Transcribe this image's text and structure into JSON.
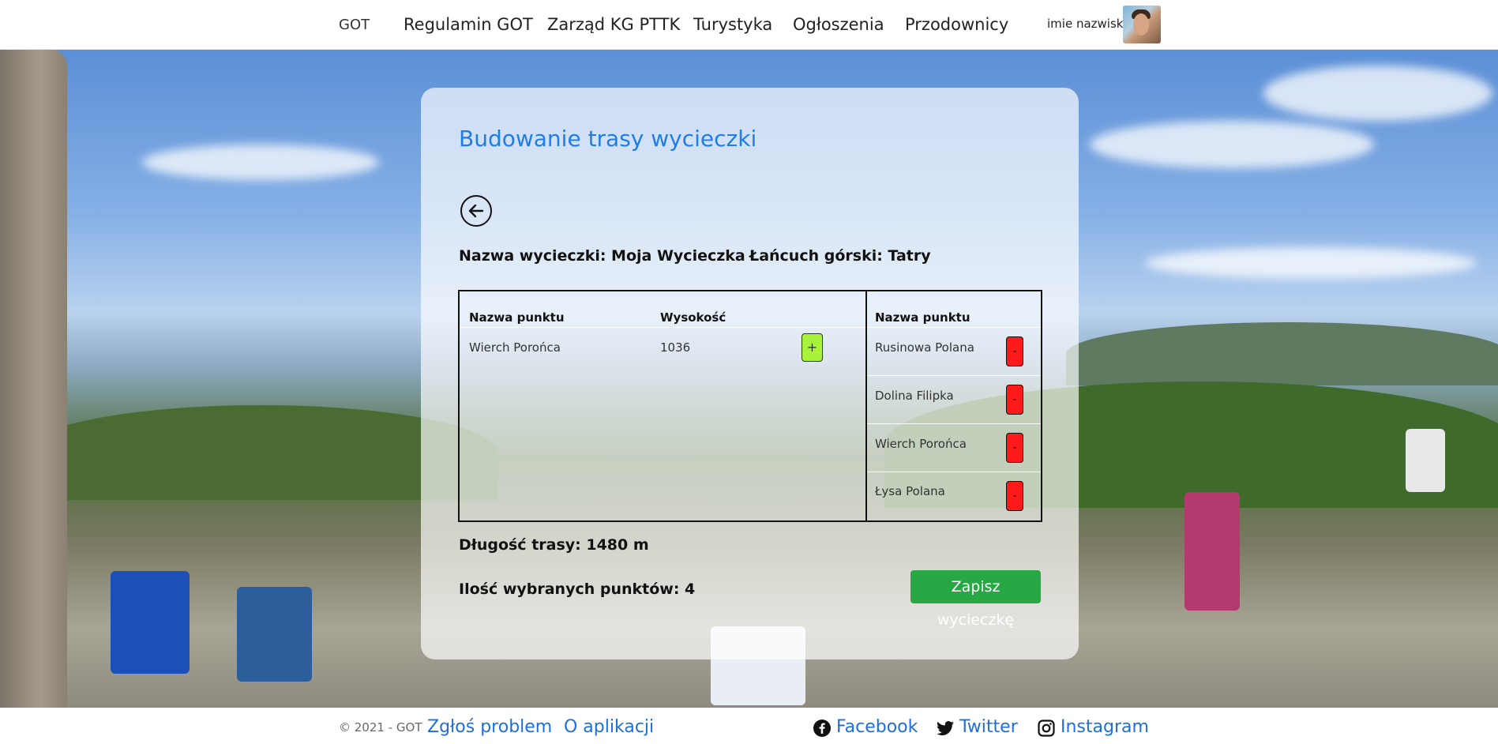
{
  "navbar": {
    "brand": "GOT",
    "links": [
      "Regulamin GOT",
      "Zarząd KG PTTK",
      "Turystyka",
      "Ogłoszenia",
      "Przodownicy"
    ],
    "user_name": "imie nazwisko"
  },
  "card": {
    "title": "Budowanie trasy wycieczki",
    "trip_name": "Nazwa wycieczki: Moja Wycieczka",
    "mountain_chain": "Łańcuch górski: Tatry",
    "available": {
      "headers": [
        "Nazwa punktu",
        "Wysokość"
      ],
      "rows": [
        {
          "name": "Wierch Porońca",
          "height": "1036",
          "action": "+"
        }
      ]
    },
    "selected": {
      "header": "Nazwa punktu",
      "rows": [
        {
          "name": "Rusinowa Polana",
          "action": "-"
        },
        {
          "name": "Dolina Filipka",
          "action": "-"
        },
        {
          "name": "Wierch Porońca",
          "action": "-"
        },
        {
          "name": "Łysa Polana",
          "action": "-"
        }
      ]
    },
    "route_length": "Długość trasy: 1480 m",
    "points_count": "Ilość wybranych punktów: 4",
    "save_label": "Zapisz wycieczkę"
  },
  "footer": {
    "copyright": "© 2021 - GOT",
    "links": [
      "Zgłoś problem",
      "O aplikacji"
    ],
    "social": [
      {
        "label": "Facebook",
        "icon": "facebook-icon"
      },
      {
        "label": "Twitter",
        "icon": "twitter-icon"
      },
      {
        "label": "Instagram",
        "icon": "instagram-icon"
      }
    ]
  },
  "colors": {
    "title_blue": "#1e7ee6",
    "add_green": "#a8f23a",
    "remove_red": "#ff1a1a",
    "save_green": "#28a745",
    "link_blue": "#1e6fd9"
  }
}
